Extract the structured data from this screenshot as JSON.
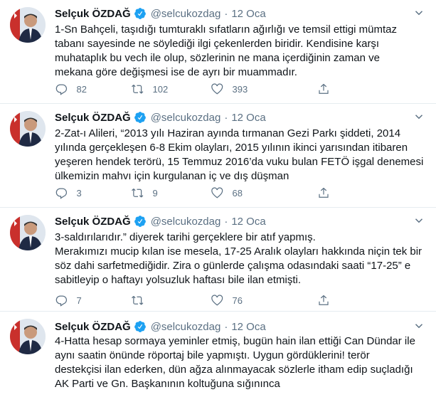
{
  "tweets": [
    {
      "author": "Selçuk ÖZDAĞ",
      "handle": "@selcukozdag",
      "separator": "·",
      "time": "12 Oca",
      "text": "1-Sn Bahçeli, taşıdığı tumturaklı sıfatların ağırlığı ve temsil ettigi mümtaz\ntabanı sayesinde ne söylediği ilgi çekenlerden biridir. Kendisine karşı\nmuhataplık bu vech ile olup, sözlerinin ne mana içerdiğinin zaman ve\nmekana göre değişmesi ise de ayrı bir muammadır.",
      "replies": "82",
      "retweets": "102",
      "likes": "393"
    },
    {
      "author": "Selçuk ÖZDAĞ",
      "handle": "@selcukozdag",
      "separator": "·",
      "time": "12 Oca",
      "text": "2-Zat-ı Alileri, “2013 yılı Haziran ayında tırmanan Gezi Parkı şiddeti, 2014\nyılında gerçekleşen 6-8 Ekim olayları, 2015 yılının ikinci yarısından itibaren\nyeşeren hendek terörü, 15 Temmuz 2016’da vuku bulan FETÖ işgal denemesi\nülkemizin mahvı için kurgulanan iç ve dış düşman",
      "replies": "3",
      "retweets": "9",
      "likes": "68"
    },
    {
      "author": "Selçuk ÖZDAĞ",
      "handle": "@selcukozdag",
      "separator": "·",
      "time": "12 Oca",
      "text": "3-saldırılarıdır.” diyerek tarihi gerçeklere bir atıf yapmış.\nMerakımızı mucip kılan ise mesela, 17-25 Aralık olayları hakkında niçin tek bir\nsöz dahi sarfetmediğidir. Zira o günlerde çalışma odasındaki saati  “17-25” e\nsabitleyip o haftayı yolsuzluk haftası bile ilan etmişti.",
      "replies": "7",
      "retweets": "",
      "likes": "76"
    },
    {
      "author": "Selçuk ÖZDAĞ",
      "handle": "@selcukozdag",
      "separator": "·",
      "time": "12 Oca",
      "text": "4-Hatta hesap sormaya yeminler etmiş, bugün hain ilan ettiği Can Dündar ile\naynı saatin önünde röportaj bile yapmıştı. Uygun gördüklerini! terör\ndestekçisi ilan ederken, dün ağza alınmayacak sözlerle itham edip suçladığı\nAK Parti ve Gn. Başkanının koltuğuna sığınınca"
    }
  ],
  "colors": {
    "text": "#0f1419",
    "secondary": "#5b7083",
    "verified": "#1da1f2",
    "divider": "#e6ecf0"
  },
  "icons": [
    "verified-badge-icon",
    "more-icon",
    "reply-icon",
    "retweet-icon",
    "like-icon",
    "share-icon"
  ]
}
